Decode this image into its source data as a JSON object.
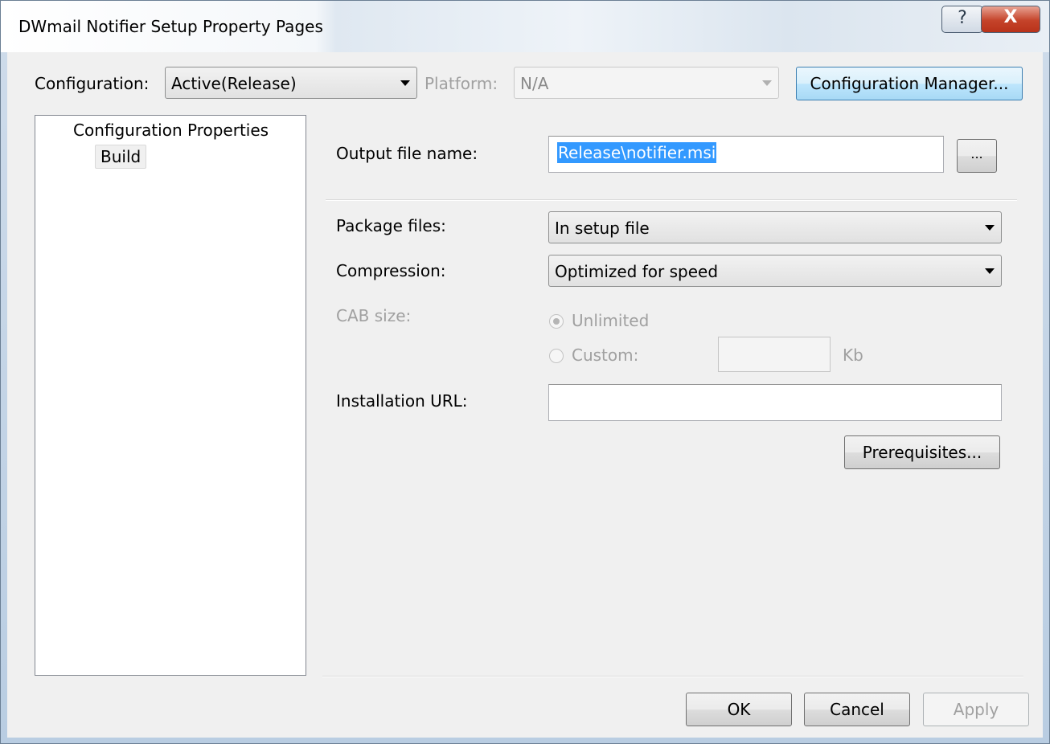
{
  "window": {
    "title": "DWmail Notifier Setup Property Pages",
    "help_glyph": "?",
    "close_glyph": "X"
  },
  "top": {
    "configuration_label": "Configuration:",
    "configuration_value": "Active(Release)",
    "platform_label": "Platform:",
    "platform_value": "N/A",
    "config_manager_button": "Configuration Manager..."
  },
  "tree": {
    "root": "Configuration Properties",
    "child": "Build"
  },
  "form": {
    "output_label": "Output file name:",
    "output_value": "Release\\notifier.msi",
    "browse_button": "...",
    "package_label": "Package files:",
    "package_value": "In setup file",
    "compression_label": "Compression:",
    "compression_value": "Optimized for speed",
    "cab_label": "CAB size:",
    "unlimited_label": "Unlimited",
    "custom_label": "Custom:",
    "kb_label": "Kb",
    "install_url_label": "Installation URL:",
    "install_url_value": "",
    "prereq_button": "Prerequisites..."
  },
  "footer": {
    "ok": "OK",
    "cancel": "Cancel",
    "apply": "Apply"
  }
}
